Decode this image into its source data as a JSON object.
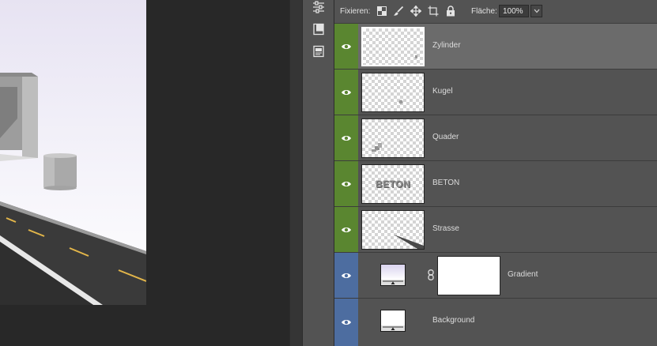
{
  "lock_bar": {
    "label": "Fixieren:",
    "icons": [
      "lock-transparent-pixels-icon",
      "lock-image-pixels-icon",
      "lock-position-icon",
      "lock-artboard-icon",
      "lock-all-icon"
    ],
    "fill_label": "Fläche:",
    "fill_value": "100%"
  },
  "side_icons": [
    "adjustments-icon",
    "libraries-icon",
    "properties-icon"
  ],
  "layers": [
    {
      "name": "Zylinder",
      "selected": true,
      "group": "green"
    },
    {
      "name": "Kugel",
      "selected": false,
      "group": "green"
    },
    {
      "name": "Quader",
      "selected": false,
      "group": "green"
    },
    {
      "name": "BETON",
      "selected": false,
      "group": "green",
      "thumb_text": "BETON"
    },
    {
      "name": "Strasse",
      "selected": false,
      "group": "green"
    },
    {
      "name": "Gradient",
      "selected": false,
      "group": "blue"
    },
    {
      "name": "Background",
      "selected": false,
      "group": "blue"
    }
  ],
  "colors": {
    "green_label": "#5a8630",
    "blue_label": "#4d6da0",
    "panel": "#535353",
    "selected_row": "#6b6b6b"
  }
}
